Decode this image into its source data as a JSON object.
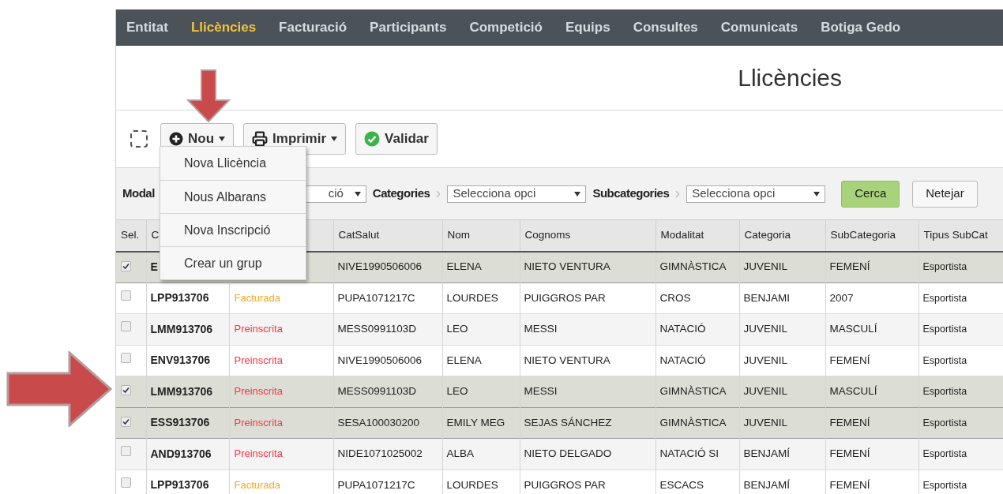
{
  "nav": [
    {
      "label": "Entitat",
      "selected": false
    },
    {
      "label": "Llicències",
      "selected": true
    },
    {
      "label": "Facturació",
      "selected": false
    },
    {
      "label": "Participants",
      "selected": false
    },
    {
      "label": "Competició",
      "selected": false
    },
    {
      "label": "Equips",
      "selected": false
    },
    {
      "label": "Consultes",
      "selected": false
    },
    {
      "label": "Comunicats",
      "selected": false
    },
    {
      "label": "Botiga Gedo",
      "selected": false
    }
  ],
  "title": "Llicències",
  "toolbar": {
    "select_all": {
      "checked": false
    },
    "buttons": [
      {
        "kind": "plus",
        "label": "Nou",
        "caret": true
      },
      {
        "kind": "print",
        "label": "Imprimir",
        "caret": true
      },
      {
        "kind": "check",
        "label": "Validar",
        "caret": false
      }
    ]
  },
  "menu": [
    "Nova Llicència",
    "Nous Albarans",
    "Nova Inscripció",
    "Crear un grup"
  ],
  "filters": [
    {
      "label": "Modal",
      "value": "ció"
    },
    {
      "label": "Categories",
      "value": "Selecciona opci"
    },
    {
      "label": "Subcategories",
      "value": "Selecciona opci"
    }
  ],
  "filter_buttons": [
    {
      "kind": "primary",
      "label": "Cerca"
    },
    {
      "kind": "default",
      "label": "Netejar"
    }
  ],
  "table": {
    "columns": [
      "Sel.",
      "C",
      "",
      "CatSalut",
      "Nom",
      "Cognoms",
      "Modalitat",
      "Categoria",
      "SubCategoria",
      "Tipus SubCat"
    ],
    "rows": [
      {
        "selected": true,
        "codi": "E",
        "catsalut": "NIVE1990506006",
        "nom": "ELENA",
        "cognoms": "NIETO VENTURA",
        "modalitat": "GIMNÀSTICA",
        "categoria": "JUVENIL",
        "subcategoria": "FEMENÍ",
        "tipus": "Esportista"
      },
      {
        "selected": false,
        "codi": "LPP913706",
        "estat": {
          "text": "Facturada",
          "color": "#f5a623"
        },
        "catsalut": "PUPA1071217C",
        "nom": "LOURDES",
        "cognoms": "PUIGGROS PAR",
        "modalitat": "CROS",
        "categoria": "BENJAMI",
        "subcategoria": "2007",
        "tipus": "Esportista"
      },
      {
        "selected": false,
        "codi": "LMM913706",
        "estat": {
          "text": "Preinscrita",
          "color": "#ff3344"
        },
        "catsalut": "MESS0991103D",
        "nom": "LEO",
        "cognoms": "MESSI",
        "modalitat": "NATACIÓ",
        "categoria": "JUVENIL",
        "subcategoria": "MASCULÍ",
        "tipus": "Esportista"
      },
      {
        "selected": false,
        "codi": "ENV913706",
        "estat": {
          "text": "Preinscrita",
          "color": "#ff3344"
        },
        "catsalut": "NIVE1990506006",
        "nom": "ELENA",
        "cognoms": "NIETO VENTURA",
        "modalitat": "NATACIÓ",
        "categoria": "JUVENIL",
        "subcategoria": "FEMENÍ",
        "tipus": "Esportista"
      },
      {
        "selected": true,
        "codi": "LMM913706",
        "estat": {
          "text": "Preinscrita",
          "color": "#ff3344"
        },
        "catsalut": "MESS0991103D",
        "nom": "LEO",
        "cognoms": "MESSI",
        "modalitat": "GIMNÀSTICA",
        "categoria": "JUVENIL",
        "subcategoria": "MASCULÍ",
        "tipus": "Esportista"
      },
      {
        "selected": true,
        "codi": "ESS913706",
        "estat": {
          "text": "Preinscrita",
          "color": "#ff3344"
        },
        "catsalut": "SESA100030200",
        "nom": "EMILY MEG",
        "cognoms": "SEJAS SÁNCHEZ",
        "modalitat": "GIMNÀSTICA",
        "categoria": "JUVENIL",
        "subcategoria": "FEMENÍ",
        "tipus": "Esportista"
      },
      {
        "selected": false,
        "codi": "AND913706",
        "estat": {
          "text": "Preinscrita",
          "color": "#ff3344"
        },
        "catsalut": "NIDE1071025002",
        "nom": "ALBA",
        "cognoms": "NIETO DELGADO",
        "modalitat": "NATACIÓ SI",
        "categoria": "BENJAMÍ",
        "subcategoria": "FEMENÍ",
        "tipus": "Esportista"
      },
      {
        "selected": false,
        "codi": "LPP913706",
        "estat": {
          "text": "Facturada",
          "color": "#f5a623"
        },
        "catsalut": "PUPA1071217C",
        "nom": "LOURDES",
        "cognoms": "PUIGGROS PAR",
        "modalitat": "ESCACS",
        "categoria": "BENJAMÍ",
        "subcategoria": "FEMENÍ",
        "tipus": "Esportista"
      }
    ]
  }
}
